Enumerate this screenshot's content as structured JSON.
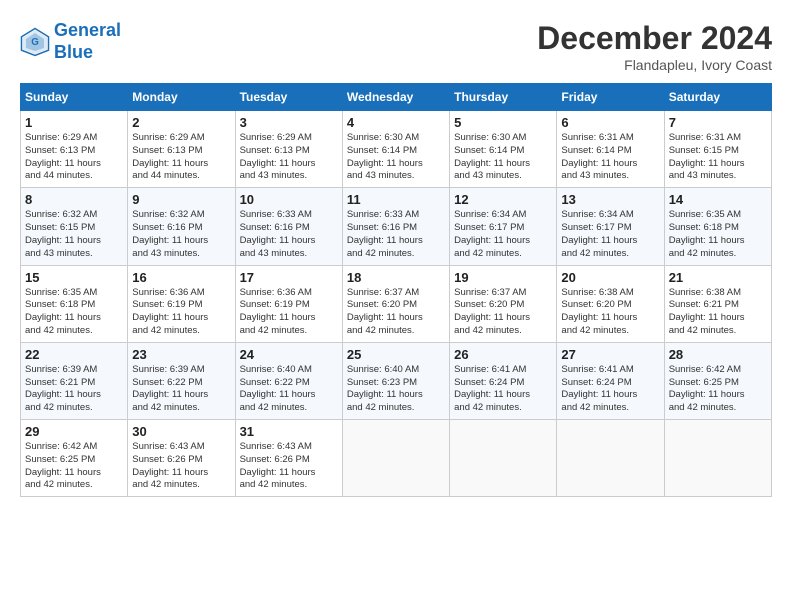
{
  "header": {
    "logo_line1": "General",
    "logo_line2": "Blue",
    "month": "December 2024",
    "location": "Flandapleu, Ivory Coast"
  },
  "columns": [
    "Sunday",
    "Monday",
    "Tuesday",
    "Wednesday",
    "Thursday",
    "Friday",
    "Saturday"
  ],
  "weeks": [
    [
      {
        "day": "1",
        "info": "Sunrise: 6:29 AM\nSunset: 6:13 PM\nDaylight: 11 hours\nand 44 minutes."
      },
      {
        "day": "2",
        "info": "Sunrise: 6:29 AM\nSunset: 6:13 PM\nDaylight: 11 hours\nand 44 minutes."
      },
      {
        "day": "3",
        "info": "Sunrise: 6:29 AM\nSunset: 6:13 PM\nDaylight: 11 hours\nand 43 minutes."
      },
      {
        "day": "4",
        "info": "Sunrise: 6:30 AM\nSunset: 6:14 PM\nDaylight: 11 hours\nand 43 minutes."
      },
      {
        "day": "5",
        "info": "Sunrise: 6:30 AM\nSunset: 6:14 PM\nDaylight: 11 hours\nand 43 minutes."
      },
      {
        "day": "6",
        "info": "Sunrise: 6:31 AM\nSunset: 6:14 PM\nDaylight: 11 hours\nand 43 minutes."
      },
      {
        "day": "7",
        "info": "Sunrise: 6:31 AM\nSunset: 6:15 PM\nDaylight: 11 hours\nand 43 minutes."
      }
    ],
    [
      {
        "day": "8",
        "info": "Sunrise: 6:32 AM\nSunset: 6:15 PM\nDaylight: 11 hours\nand 43 minutes."
      },
      {
        "day": "9",
        "info": "Sunrise: 6:32 AM\nSunset: 6:16 PM\nDaylight: 11 hours\nand 43 minutes."
      },
      {
        "day": "10",
        "info": "Sunrise: 6:33 AM\nSunset: 6:16 PM\nDaylight: 11 hours\nand 43 minutes."
      },
      {
        "day": "11",
        "info": "Sunrise: 6:33 AM\nSunset: 6:16 PM\nDaylight: 11 hours\nand 42 minutes."
      },
      {
        "day": "12",
        "info": "Sunrise: 6:34 AM\nSunset: 6:17 PM\nDaylight: 11 hours\nand 42 minutes."
      },
      {
        "day": "13",
        "info": "Sunrise: 6:34 AM\nSunset: 6:17 PM\nDaylight: 11 hours\nand 42 minutes."
      },
      {
        "day": "14",
        "info": "Sunrise: 6:35 AM\nSunset: 6:18 PM\nDaylight: 11 hours\nand 42 minutes."
      }
    ],
    [
      {
        "day": "15",
        "info": "Sunrise: 6:35 AM\nSunset: 6:18 PM\nDaylight: 11 hours\nand 42 minutes."
      },
      {
        "day": "16",
        "info": "Sunrise: 6:36 AM\nSunset: 6:19 PM\nDaylight: 11 hours\nand 42 minutes."
      },
      {
        "day": "17",
        "info": "Sunrise: 6:36 AM\nSunset: 6:19 PM\nDaylight: 11 hours\nand 42 minutes."
      },
      {
        "day": "18",
        "info": "Sunrise: 6:37 AM\nSunset: 6:20 PM\nDaylight: 11 hours\nand 42 minutes."
      },
      {
        "day": "19",
        "info": "Sunrise: 6:37 AM\nSunset: 6:20 PM\nDaylight: 11 hours\nand 42 minutes."
      },
      {
        "day": "20",
        "info": "Sunrise: 6:38 AM\nSunset: 6:20 PM\nDaylight: 11 hours\nand 42 minutes."
      },
      {
        "day": "21",
        "info": "Sunrise: 6:38 AM\nSunset: 6:21 PM\nDaylight: 11 hours\nand 42 minutes."
      }
    ],
    [
      {
        "day": "22",
        "info": "Sunrise: 6:39 AM\nSunset: 6:21 PM\nDaylight: 11 hours\nand 42 minutes."
      },
      {
        "day": "23",
        "info": "Sunrise: 6:39 AM\nSunset: 6:22 PM\nDaylight: 11 hours\nand 42 minutes."
      },
      {
        "day": "24",
        "info": "Sunrise: 6:40 AM\nSunset: 6:22 PM\nDaylight: 11 hours\nand 42 minutes."
      },
      {
        "day": "25",
        "info": "Sunrise: 6:40 AM\nSunset: 6:23 PM\nDaylight: 11 hours\nand 42 minutes."
      },
      {
        "day": "26",
        "info": "Sunrise: 6:41 AM\nSunset: 6:24 PM\nDaylight: 11 hours\nand 42 minutes."
      },
      {
        "day": "27",
        "info": "Sunrise: 6:41 AM\nSunset: 6:24 PM\nDaylight: 11 hours\nand 42 minutes."
      },
      {
        "day": "28",
        "info": "Sunrise: 6:42 AM\nSunset: 6:25 PM\nDaylight: 11 hours\nand 42 minutes."
      }
    ],
    [
      {
        "day": "29",
        "info": "Sunrise: 6:42 AM\nSunset: 6:25 PM\nDaylight: 11 hours\nand 42 minutes."
      },
      {
        "day": "30",
        "info": "Sunrise: 6:43 AM\nSunset: 6:26 PM\nDaylight: 11 hours\nand 42 minutes."
      },
      {
        "day": "31",
        "info": "Sunrise: 6:43 AM\nSunset: 6:26 PM\nDaylight: 11 hours\nand 42 minutes."
      },
      {
        "day": "",
        "info": ""
      },
      {
        "day": "",
        "info": ""
      },
      {
        "day": "",
        "info": ""
      },
      {
        "day": "",
        "info": ""
      }
    ]
  ]
}
